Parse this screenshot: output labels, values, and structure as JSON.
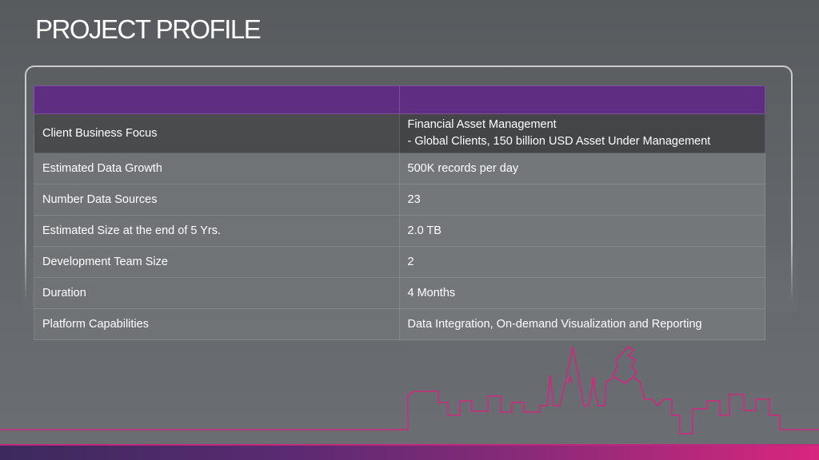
{
  "slide": {
    "title": "PROJECT PROFILE"
  },
  "table": {
    "header": [
      "",
      ""
    ],
    "rows": [
      {
        "label": "Client Business Focus",
        "value_lines": [
          "Financial Asset Management",
          "- Global Clients, 150 billion USD Asset Under Management"
        ]
      },
      {
        "label": "Estimated Data Growth",
        "value": "500K records per day"
      },
      {
        "label": "Number Data Sources",
        "value": "23"
      },
      {
        "label": "Estimated Size at the end of 5 Yrs.",
        "value": "2.0 TB"
      },
      {
        "label": "Development Team Size",
        "value": "2"
      },
      {
        "label": "Duration",
        "value": "4 Months"
      },
      {
        "label": "Platform Capabilities",
        "value": "Data Integration, On-demand Visualization and Reporting"
      }
    ]
  },
  "colors": {
    "header_purple": "#5f2d82",
    "accent_magenta": "#d8267e",
    "background_gray": "#62666a"
  },
  "decorations": {
    "skyline": "city-skyline-outline-icon"
  }
}
